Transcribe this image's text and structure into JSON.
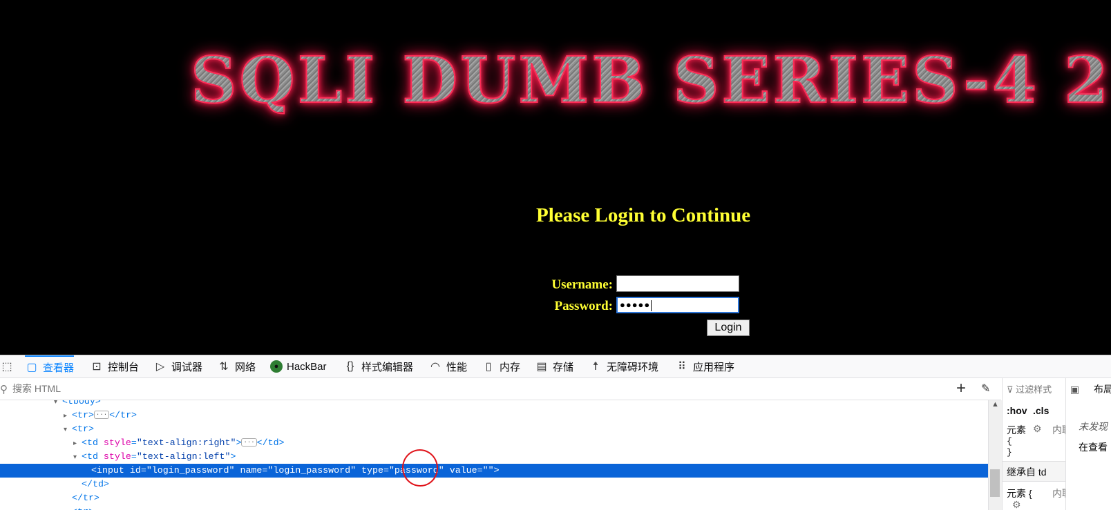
{
  "page": {
    "banner": "SQLI DUMB SERIES-4 2",
    "heading": "Please Login to Continue",
    "username_label": "Username:",
    "password_label": "Password:",
    "username_value": "",
    "password_mask": "●●●●●",
    "login_button": "Login"
  },
  "devtools": {
    "tabs": [
      {
        "label": "查看器",
        "icon": "inspector-icon"
      },
      {
        "label": "控制台",
        "icon": "console-icon"
      },
      {
        "label": "调试器",
        "icon": "debugger-icon"
      },
      {
        "label": "网络",
        "icon": "network-icon"
      },
      {
        "label": "HackBar",
        "icon": "hackbar-icon"
      },
      {
        "label": "样式编辑器",
        "icon": "style-editor-icon"
      },
      {
        "label": "性能",
        "icon": "performance-icon"
      },
      {
        "label": "内存",
        "icon": "memory-icon"
      },
      {
        "label": "存储",
        "icon": "storage-icon"
      },
      {
        "label": "无障碍环境",
        "icon": "accessibility-icon"
      },
      {
        "label": "应用程序",
        "icon": "application-icon"
      }
    ],
    "search_placeholder": "搜索 HTML",
    "tree": {
      "tbody": "<tbody>",
      "tr_open": "<tr>",
      "tr_close": "</tr>",
      "td_open": "<td ",
      "td_close": "</td>",
      "style_attr": "style",
      "td_right_value": "\"text-align:right\"",
      "td_left_value": "\"text-align:left\"",
      "input_tag": "<input ",
      "id_attr": "id",
      "id_value": "\"login_password\"",
      "name_attr": "name",
      "name_value": "\"login_password\"",
      "type_attr": "type",
      "type_value": "\"password\"",
      "value_attr": "value",
      "value_value": "\"\"",
      "tag_end": ">"
    },
    "rules": {
      "filter_placeholder": "过滤样式",
      "hov": ":hov",
      "cls": ".cls",
      "element_label": "元素",
      "inline_label": "内联",
      "brace_open": "{",
      "brace_close": "}",
      "inherited_label": "继承自 td",
      "element_label2": "元素 {",
      "inline_label2": "内联"
    },
    "layout": {
      "title": "布局",
      "line1": "未发现",
      "line2": "在查看"
    }
  }
}
